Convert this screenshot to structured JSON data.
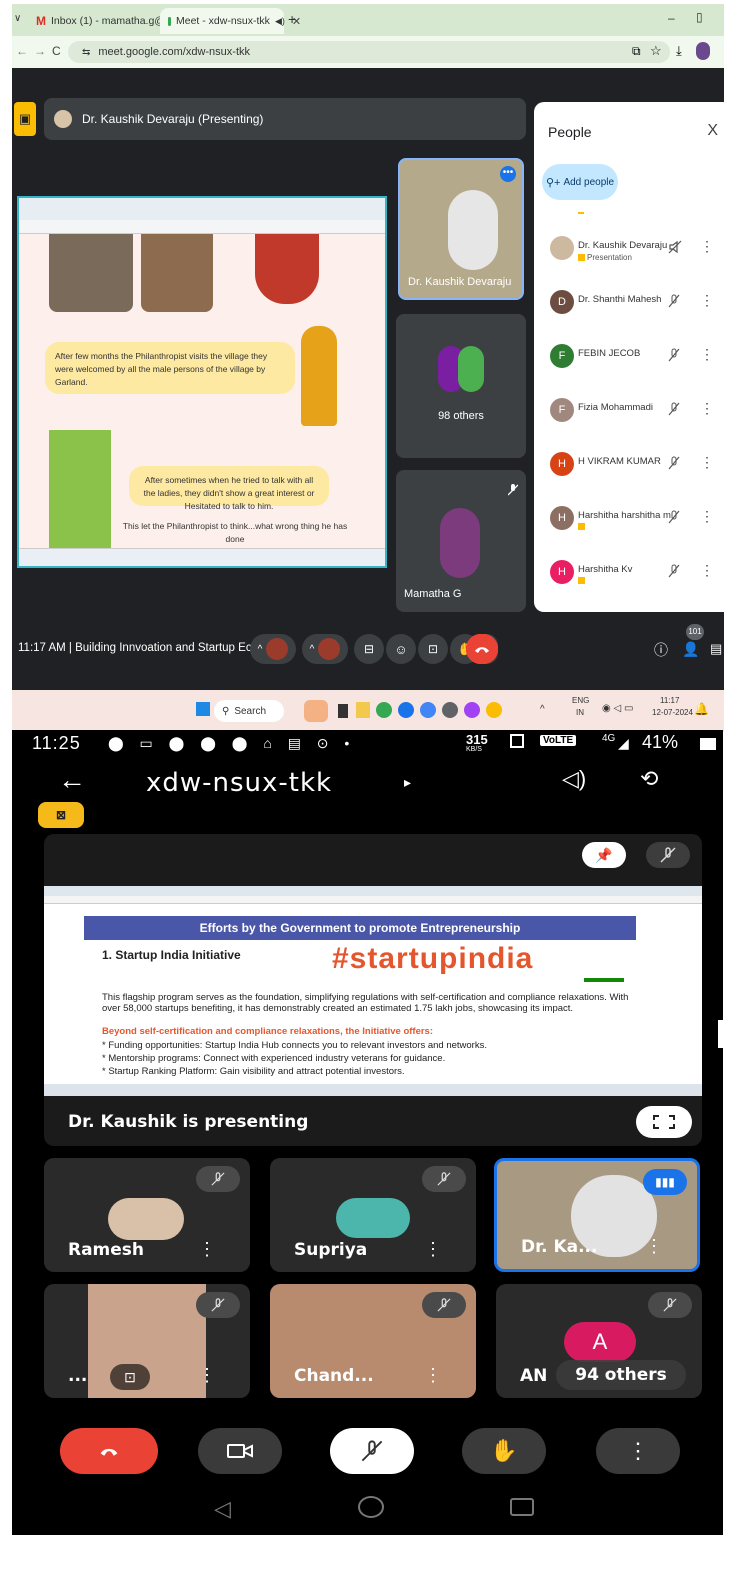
{
  "browser": {
    "tabs": [
      {
        "label": "Inbox (1) - mamatha.g@eastpo",
        "icon": "gmail-icon"
      },
      {
        "label": "Meet - xdw-nsux-tkk",
        "icon": "meet-icon"
      }
    ],
    "url": "meet.google.com/xdw-nsux-tkk",
    "new_tab": "+",
    "minimize": "–"
  },
  "meet_desktop": {
    "presenter_banner": "Dr. Kaushik Devaraju (Presenting)",
    "slide": {
      "text1": "After few months the Philanthropist visits the village they were welcomed by all the male persons of the village by Garland.",
      "text2": "After sometimes when he tried to talk with all the ladies, they didn't show a great interest or Hesitated to talk to him.",
      "text3": "This let the Philanthropist to think...what wrong thing he has done"
    },
    "tiles": [
      {
        "name": "Dr. Kaushik Devaraju"
      },
      {
        "name": "98 others"
      },
      {
        "name": "Mamatha G"
      }
    ],
    "people_panel": {
      "title": "People",
      "close": "X",
      "add_people": "Add people",
      "participants": [
        {
          "initial": "",
          "name": "Dr. Kaushik Devaraju",
          "sub": "Presentation",
          "color": "#8a6d5a"
        },
        {
          "initial": "D",
          "name": "Dr. Shanthi Mahesh",
          "sub": "",
          "color": "#6d4c41"
        },
        {
          "initial": "F",
          "name": "FEBIN JECOB",
          "sub": "",
          "color": "#2e7d32"
        },
        {
          "initial": "F",
          "name": "Fizia Mohammadi",
          "sub": "",
          "color": "#a1887f"
        },
        {
          "initial": "H",
          "name": "H VIKRAM KUMAR",
          "sub": "",
          "color": "#d84315"
        },
        {
          "initial": "H",
          "name": "Harshitha harshitha m",
          "sub": "",
          "color": "#8d6e63"
        },
        {
          "initial": "H",
          "name": "Harshitha Kv",
          "sub": "",
          "color": "#e91e63"
        }
      ]
    },
    "bottom": {
      "time_title": "11:17 AM  |  Building Innvoation and Startup Eco-Sys...",
      "participant_count": "101"
    }
  },
  "taskbar": {
    "search": "Search",
    "lang": "ENG",
    "region": "IN",
    "time": "11:17",
    "date": "12-07-2024"
  },
  "phone": {
    "status": {
      "time": "11:25",
      "speed": "315",
      "speed_unit": "KB/S",
      "volte": "VoLTE",
      "network": "4G",
      "battery": "41%"
    },
    "meeting_code": "xdw-nsux-tkk",
    "shared_slide": {
      "banner": "Efforts by the Government to promote Entrepreneurship",
      "heading": "1. Startup India Initiative",
      "hashtag": "#startupindia",
      "para": "This flagship program serves as the foundation, simplifying regulations with self-certification and compliance relaxations. With over 58,000 startups benefiting, it has demonstrably created an estimated 1.75 lakh jobs, showcasing its impact.",
      "subhead": "Beyond self-certification and compliance relaxations, the Initiative offers:",
      "bullets": [
        "* Funding opportunities: Startup India Hub connects you to relevant investors and networks.",
        "* Mentorship programs: Connect with experienced industry veterans for guidance.",
        "* Startup Ranking Platform: Gain visibility and attract potential investors."
      ]
    },
    "presenting_label": "Dr. Kaushik is presenting",
    "participants": [
      {
        "name": "Ramesh"
      },
      {
        "name": "Supriya"
      },
      {
        "name": "Dr. Ka..."
      },
      {
        "name": "..."
      },
      {
        "name": "Chand..."
      },
      {
        "name": "AN",
        "badge": "94 others",
        "initial": "A"
      }
    ]
  },
  "colors": {
    "meet_dark": "#202124",
    "end_call_red": "#ea4335",
    "meet_blue": "#1a73e8",
    "people_chip": "#c2e7ff"
  }
}
